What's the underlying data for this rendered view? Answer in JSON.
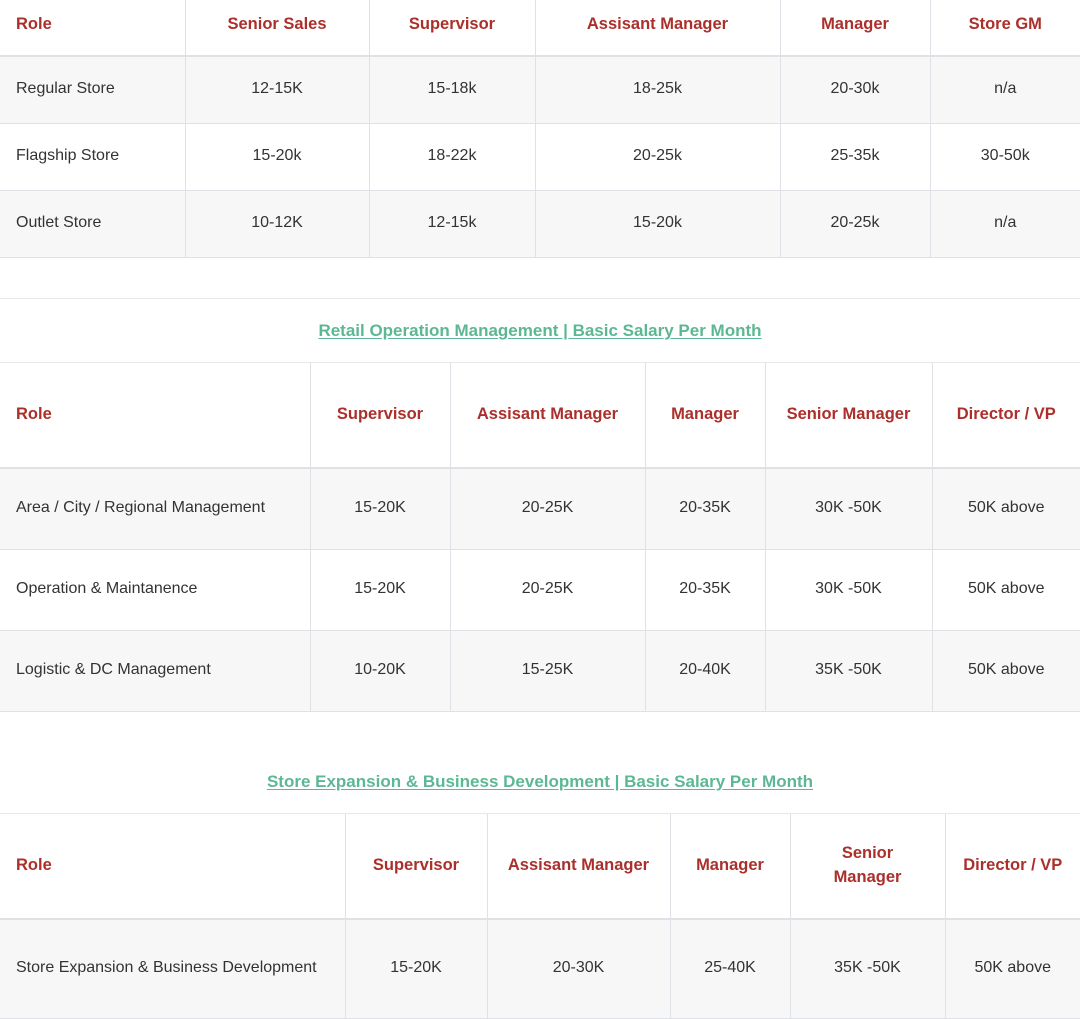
{
  "tables": [
    {
      "id": "store-roles-table",
      "heading": null,
      "columns": [
        "Role",
        "Senior Sales",
        "Supervisor",
        "Assisant Manager",
        "Manager",
        "Store GM"
      ],
      "rows": [
        [
          "Regular Store",
          "12-15K",
          "15-18k",
          "18-25k",
          "20-30k",
          "n/a"
        ],
        [
          "Flagship Store",
          "15-20k",
          "18-22k",
          "20-25k",
          "25-35k",
          "30-50k"
        ],
        [
          "Outlet Store",
          "10-12K",
          "12-15k",
          "15-20k",
          "20-25k",
          "n/a"
        ]
      ]
    },
    {
      "id": "retail-operation-management-table",
      "heading": "Retail Operation Management | Basic Salary Per Month",
      "columns": [
        "Role",
        "Supervisor",
        "Assisant Manager",
        "Manager",
        "Senior Manager",
        "Director / VP"
      ],
      "rows": [
        [
          "Area / City / Regional Management",
          "15-20K",
          "20-25K",
          "20-35K",
          "30K -50K",
          "50K above"
        ],
        [
          "Operation & Maintanence",
          "15-20K",
          "20-25K",
          "20-35K",
          "30K -50K",
          "50K above"
        ],
        [
          "Logistic & DC Management",
          "10-20K",
          "15-25K",
          "20-40K",
          "35K -50K",
          "50K above"
        ]
      ]
    },
    {
      "id": "store-expansion-business-development-table",
      "heading": "Store Expansion & Business Development | Basic Salary Per Month",
      "columns": [
        "Role",
        "Supervisor",
        "Assisant Manager",
        "Manager",
        "Senior Manager",
        "Director / VP"
      ],
      "rows": [
        [
          "Store Expansion & Business Development",
          "15-20K",
          "20-30K",
          "25-40K",
          "35K -50K",
          "50K above"
        ]
      ]
    }
  ],
  "colors": {
    "header_text": "#ab2f2a",
    "link": "#5cb894",
    "body_text": "#333333",
    "border": "#dfe1e6",
    "row_alt_background": "#f7f7f8"
  }
}
